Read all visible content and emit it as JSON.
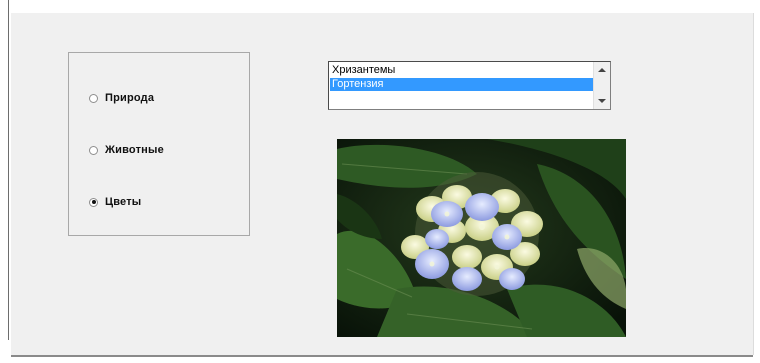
{
  "categories": {
    "options": [
      {
        "label": "Природа",
        "selected": false
      },
      {
        "label": "Животные",
        "selected": false
      },
      {
        "label": "Цветы",
        "selected": true
      }
    ]
  },
  "flower_list": {
    "items": [
      "Хризантемы",
      "Гортензия"
    ],
    "selected_index": 1
  },
  "preview": {
    "subject": "hydrangea-flower-photo"
  },
  "colors": {
    "selection": "#3399ff",
    "window_bg": "#f0f0f0"
  }
}
